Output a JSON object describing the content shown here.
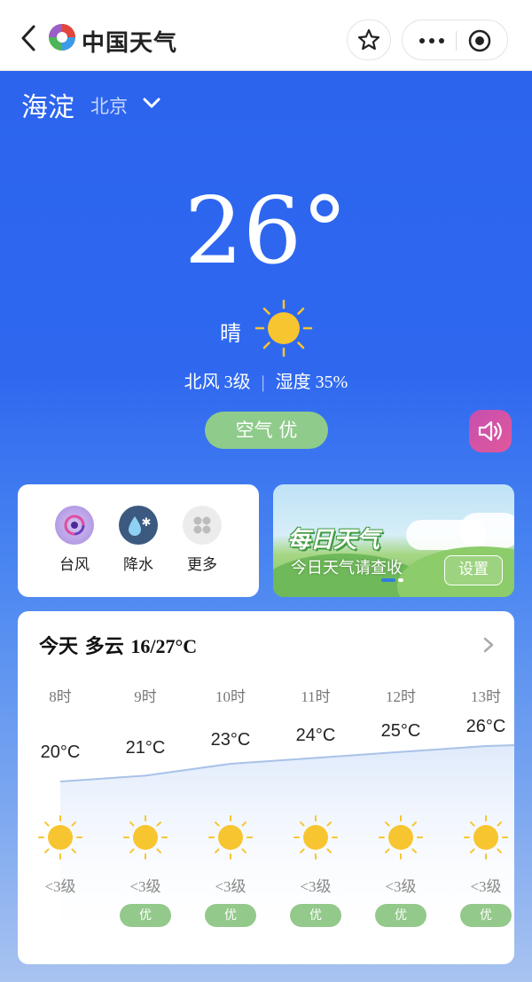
{
  "nav": {
    "app_title": "中国天气"
  },
  "location": {
    "district": "海淀",
    "city": "北京"
  },
  "current": {
    "temperature": "26°",
    "condition": "晴",
    "wind": "北风 3级",
    "separator": "|",
    "humidity": "湿度 35%",
    "air_quality": "空气 优"
  },
  "shortcuts": [
    {
      "label": "台风",
      "icon": "typhoon-icon"
    },
    {
      "label": "降水",
      "icon": "rain-icon"
    },
    {
      "label": "更多",
      "icon": "more-grid-icon"
    }
  ],
  "banner": {
    "title": "每日天气",
    "subtitle": "今日天气请查收",
    "button": "设置"
  },
  "forecast": {
    "day": "今天",
    "condition": "多云",
    "range": "16/27°C",
    "hours": [
      {
        "time": "8时",
        "temp": "20°C",
        "wind": "<3级",
        "aqi": ""
      },
      {
        "time": "9时",
        "temp": "21°C",
        "wind": "<3级",
        "aqi": "优"
      },
      {
        "time": "10时",
        "temp": "23°C",
        "wind": "<3级",
        "aqi": "优"
      },
      {
        "time": "11时",
        "temp": "24°C",
        "wind": "<3级",
        "aqi": "优"
      },
      {
        "time": "12时",
        "temp": "25°C",
        "wind": "<3级",
        "aqi": "优"
      },
      {
        "time": "13时",
        "temp": "26°C",
        "wind": "<3级",
        "aqi": "优"
      }
    ]
  },
  "colors": {
    "sky": "#2f68ef",
    "aqi_good": "#8fcb8a",
    "sun": "#f7c530"
  }
}
